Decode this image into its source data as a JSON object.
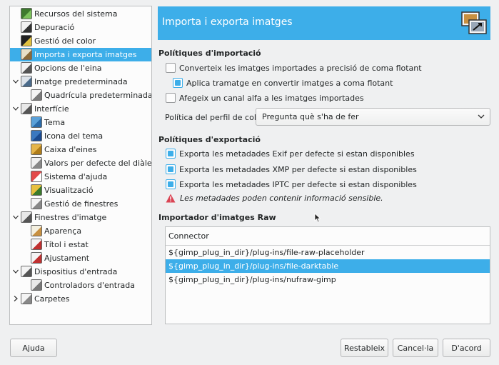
{
  "tree": {
    "items": [
      {
        "label": "Recursos del sistema",
        "level": 0,
        "expandable": false,
        "icon": "memory-chip-icon",
        "selected": false
      },
      {
        "label": "Depuració",
        "level": 0,
        "expandable": false,
        "icon": "bug-icon",
        "selected": false
      },
      {
        "label": "Gestió del color",
        "level": 0,
        "expandable": false,
        "icon": "color-management-icon",
        "selected": false
      },
      {
        "label": "Importa i exporta imatges",
        "level": 0,
        "expandable": false,
        "icon": "import-export-icon",
        "selected": true
      },
      {
        "label": "Opcions de l'eina",
        "level": 0,
        "expandable": false,
        "icon": "tool-options-icon",
        "selected": false
      },
      {
        "label": "Imatge predeterminada",
        "level": 0,
        "expandable": true,
        "icon": "default-image-icon",
        "selected": false
      },
      {
        "label": "Quadrícula predeterminada",
        "level": 1,
        "expandable": false,
        "icon": "grid-icon",
        "selected": false
      },
      {
        "label": "Interfície",
        "level": 0,
        "expandable": true,
        "icon": "interface-icon",
        "selected": false
      },
      {
        "label": "Tema",
        "level": 1,
        "expandable": false,
        "icon": "theme-icon",
        "selected": false
      },
      {
        "label": "Icona del tema",
        "level": 1,
        "expandable": false,
        "icon": "icon-theme-icon",
        "selected": false
      },
      {
        "label": "Caixa d'eines",
        "level": 1,
        "expandable": false,
        "icon": "toolbox-icon",
        "selected": false
      },
      {
        "label": "Valors per defecte del diàleg",
        "level": 1,
        "expandable": false,
        "icon": "dialog-defaults-icon",
        "selected": false
      },
      {
        "label": "Sistema d'ajuda",
        "level": 1,
        "expandable": false,
        "icon": "help-system-icon",
        "selected": false
      },
      {
        "label": "Visualització",
        "level": 1,
        "expandable": false,
        "icon": "display-icon",
        "selected": false
      },
      {
        "label": "Gestió de finestres",
        "level": 1,
        "expandable": false,
        "icon": "window-management-icon",
        "selected": false
      },
      {
        "label": "Finestres d'imatge",
        "level": 0,
        "expandable": true,
        "icon": "image-windows-icon",
        "selected": false
      },
      {
        "label": "Aparença",
        "level": 1,
        "expandable": false,
        "icon": "appearance-icon",
        "selected": false
      },
      {
        "label": "Títol i estat",
        "level": 1,
        "expandable": false,
        "icon": "title-status-icon",
        "selected": false
      },
      {
        "label": "Ajustament",
        "level": 1,
        "expandable": false,
        "icon": "snapping-icon",
        "selected": false
      },
      {
        "label": "Dispositius d'entrada",
        "level": 0,
        "expandable": true,
        "icon": "input-devices-icon",
        "selected": false
      },
      {
        "label": "Controladors d'entrada",
        "level": 1,
        "expandable": false,
        "icon": "input-controllers-icon",
        "selected": false
      },
      {
        "label": "Carpetes",
        "level": 0,
        "expandable": true,
        "collapsed": true,
        "icon": "folders-icon",
        "selected": false
      }
    ]
  },
  "header": {
    "title": "Importa i exporta imatges",
    "icon": "import-export-icon"
  },
  "import_policies": {
    "title": "Polítiques d'importació",
    "options": [
      {
        "label": "Converteix les imatges importades a precisió de coma flotant",
        "checked": false
      },
      {
        "label": "Aplica tramatge en convertir imatges a coma flotant",
        "checked": true
      },
      {
        "label": "Afegeix un canal alfa a les imatges importades",
        "checked": false
      }
    ],
    "color_profile_label": "Política del perfil de color:",
    "color_profile_value": "Pregunta què s'ha de fer"
  },
  "export_policies": {
    "title": "Polítiques d'exportació",
    "options": [
      {
        "label": "Exporta les metadades Exif per defecte si estan disponibles",
        "checked": true
      },
      {
        "label": "Exporta les metadades XMP per defecte si estan disponibles",
        "checked": true
      },
      {
        "label": "Exporta les metadades IPTC per defecte si estan disponibles",
        "checked": true
      }
    ],
    "warning": "Les metadades poden contenir informació sensible."
  },
  "raw_importer": {
    "title": "Importador d'imatges Raw",
    "column_header": "Connector",
    "rows": [
      {
        "value": "${gimp_plug_in_dir}/plug-ins/file-raw-placeholder",
        "selected": false
      },
      {
        "value": "${gimp_plug_in_dir}/plug-ins/file-darktable",
        "selected": true
      },
      {
        "value": "${gimp_plug_in_dir}/plug-ins/nufraw-gimp",
        "selected": false
      }
    ]
  },
  "buttons": {
    "help": "Ajuda",
    "reset": "Restableix",
    "cancel": "Cancel·la",
    "ok": "D'acord"
  },
  "colors": {
    "accent": "#3daee9",
    "warning": "#da4453",
    "background": "#eff0f1"
  }
}
